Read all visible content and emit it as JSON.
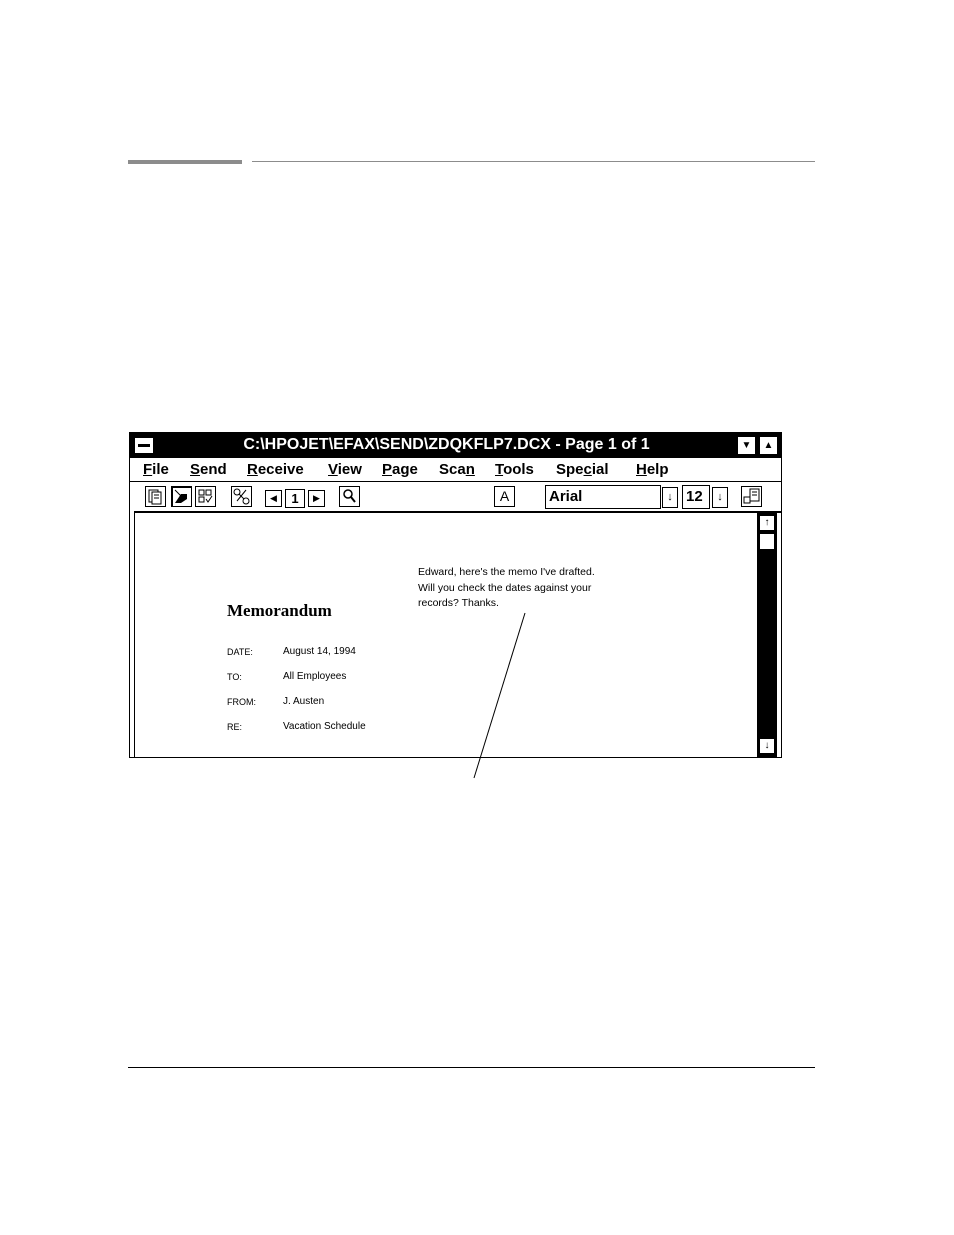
{
  "window": {
    "title": "C:\\HPOJET\\EFAX\\SEND\\ZDQKFLP7.DCX - Page 1 of 1",
    "minimize_glyph": "▼",
    "maximize_glyph": "▲"
  },
  "menu": {
    "items": [
      {
        "label": "File",
        "key": "F"
      },
      {
        "label": "Send",
        "key": "S"
      },
      {
        "label": "Receive",
        "key": "R"
      },
      {
        "label": "View",
        "key": "V"
      },
      {
        "label": "Page",
        "key": "P"
      },
      {
        "label": "Scan",
        "key": "n"
      },
      {
        "label": "Tools",
        "key": "T"
      },
      {
        "label": "Special",
        "key": "c"
      },
      {
        "label": "Help",
        "key": "H"
      }
    ]
  },
  "toolbar": {
    "page_number": "1",
    "text_tool": "A",
    "font": "Arial",
    "font_size": "12",
    "prev_glyph": "◀",
    "next_glyph": "▶",
    "dropdown_glyph": "↓"
  },
  "document": {
    "note_lines": [
      "Edward, here's the memo I've drafted.",
      "Will you check the dates against your",
      "records?  Thanks."
    ],
    "memo_title": "Memorandum",
    "fields": [
      {
        "label": "DATE:",
        "value": "August 14, 1994"
      },
      {
        "label": "TO:",
        "value": "All Employees"
      },
      {
        "label": "FROM:",
        "value": "J. Austen"
      },
      {
        "label": "RE:",
        "value": "Vacation Schedule"
      }
    ]
  },
  "scrollbar": {
    "up_glyph": "↑",
    "down_glyph": "↓"
  }
}
